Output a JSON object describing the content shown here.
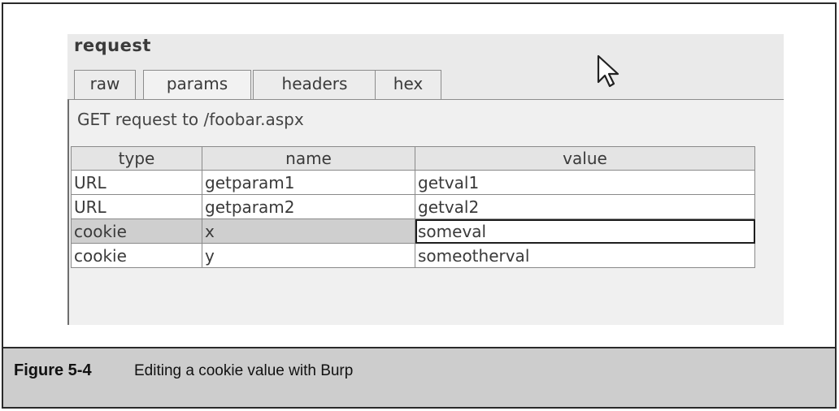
{
  "panel": {
    "title": "request",
    "tabs": [
      {
        "label": "raw",
        "active": false
      },
      {
        "label": "params",
        "active": true
      },
      {
        "label": "headers",
        "active": false
      },
      {
        "label": "hex",
        "active": false
      }
    ],
    "request_line": "GET request to /foobar.aspx",
    "table": {
      "columns": [
        "type",
        "name",
        "value"
      ],
      "rows": [
        {
          "type": "URL",
          "name": "getparam1",
          "value": "getval1",
          "selected": false
        },
        {
          "type": "URL",
          "name": "getparam2",
          "value": "getval2",
          "selected": false
        },
        {
          "type": "cookie",
          "name": "x",
          "value": "someval",
          "selected": true,
          "editing": "value"
        },
        {
          "type": "cookie",
          "name": "y",
          "value": "someotherval",
          "selected": false
        }
      ]
    },
    "cursor_icon": "arrow-pointer-icon"
  },
  "caption": {
    "label": "Figure 5-4",
    "text": "Editing a cookie value with Burp"
  },
  "colors": {
    "panel_bg": "#eaeaea",
    "selected_row": "#cfcfcf",
    "caption_bg": "#cdcdcd",
    "frame_border": "#2a2a2a"
  }
}
